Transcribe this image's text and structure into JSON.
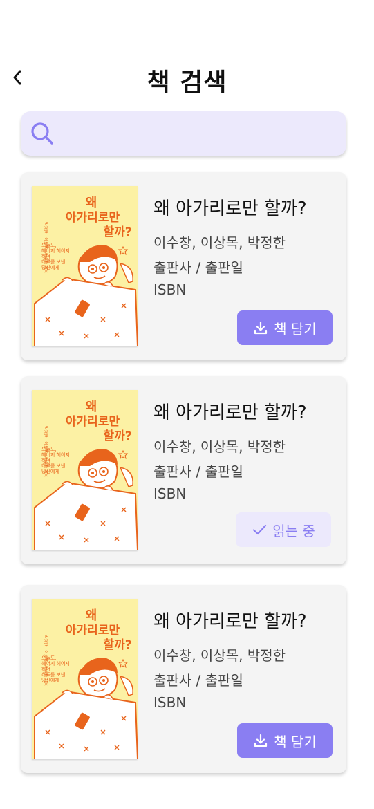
{
  "header": {
    "title": "책 검색",
    "back_icon": "chevron-left-icon"
  },
  "search": {
    "placeholder": "",
    "value": "",
    "icon": "search-icon"
  },
  "colors": {
    "accent": "#8a7ef2",
    "accent_light": "#ece9fc",
    "card_bg": "#f4f4f4",
    "cover_bg": "#fcf1a4",
    "cover_ink": "#e8641c"
  },
  "cover": {
    "title_line1": "왜",
    "title_line2": "아가리로만",
    "title_line3": "할까?",
    "side_text": "박정한 · 이상목 · 이수창 지음",
    "subtitle_line1": "오늘도,",
    "subtitle_line2": "헤어지 헤어지",
    "subtitle_line3": "하며",
    "subtitle_line4": "하루를 보낸",
    "subtitle_line5": "당신에게"
  },
  "results": [
    {
      "title": "왜 아가리로만 할까?",
      "authors": "이수창,  이상목, 박정한",
      "publisher": "출판사 / 출판일",
      "isbn": "ISBN",
      "action": {
        "label": "책 담기",
        "icon": "download-icon",
        "state": "add"
      }
    },
    {
      "title": "왜 아가리로만 할까?",
      "authors": "이수창,  이상목, 박정한",
      "publisher": "출판사 / 출판일",
      "isbn": "ISBN",
      "action": {
        "label": "읽는 중",
        "icon": "check-icon",
        "state": "reading"
      }
    },
    {
      "title": "왜 아가리로만 할까?",
      "authors": "이수창,  이상목, 박정한",
      "publisher": "출판사 / 출판일",
      "isbn": "ISBN",
      "action": {
        "label": "책 담기",
        "icon": "download-icon",
        "state": "add"
      }
    }
  ]
}
